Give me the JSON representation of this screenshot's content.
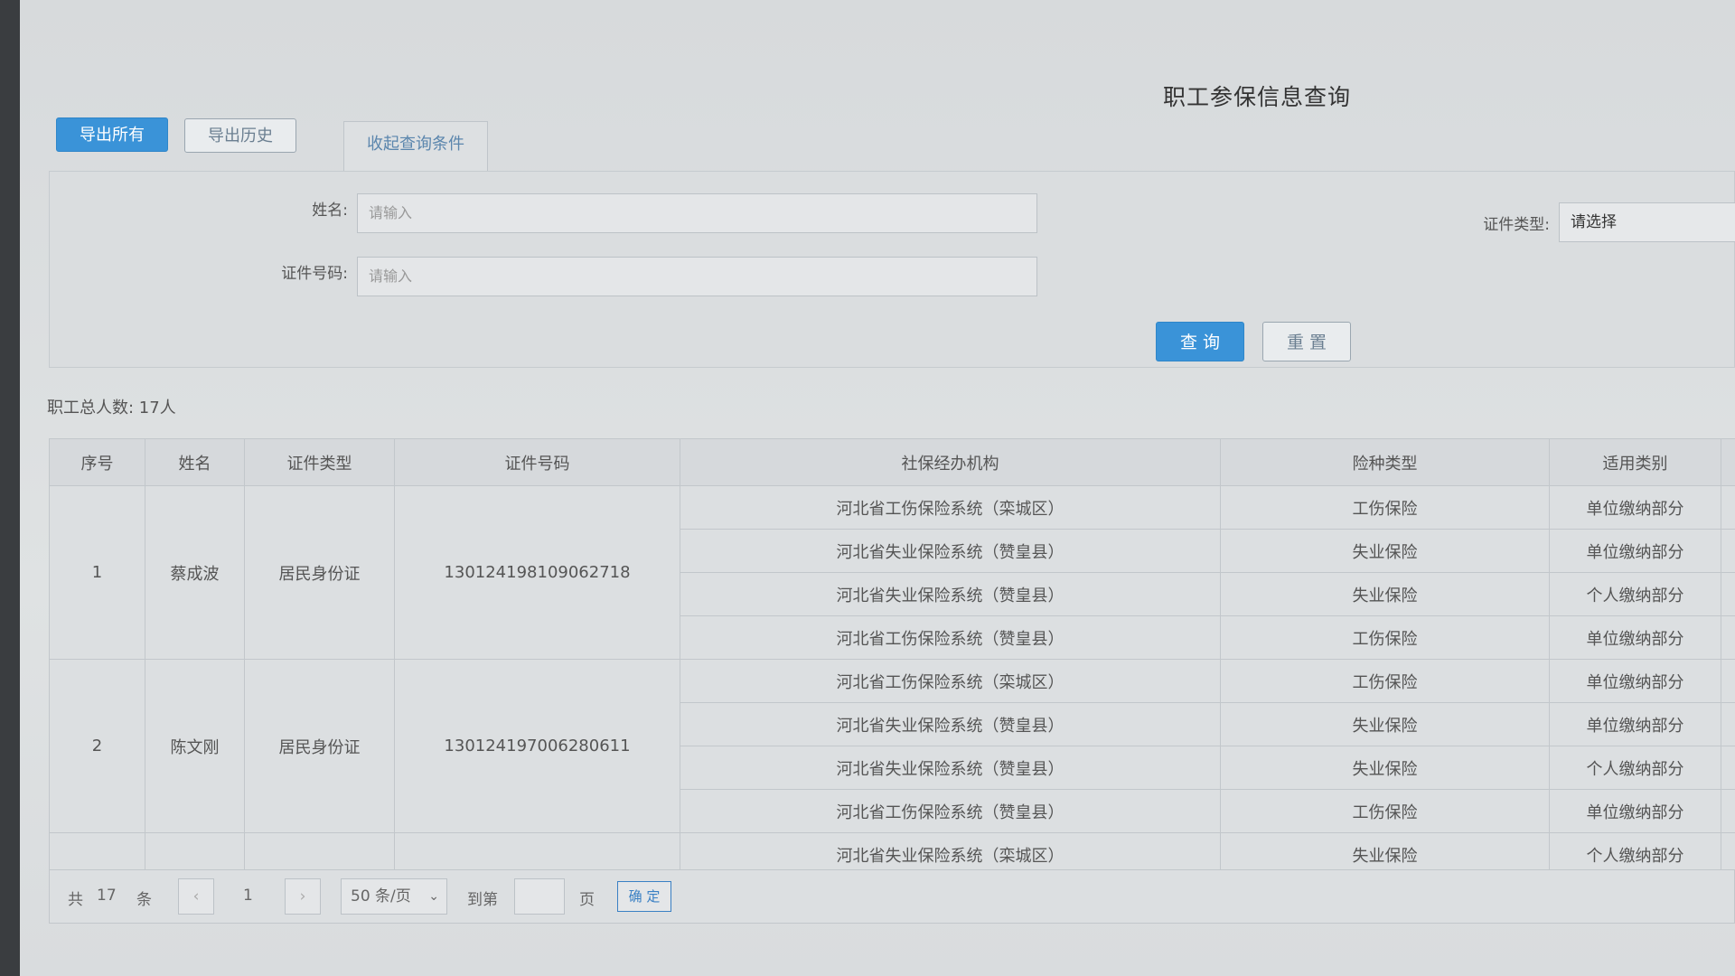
{
  "page": {
    "title": "职工参保信息查询"
  },
  "toolbar": {
    "export_all_label": "导出所有",
    "export_history_label": "导出历史",
    "collapse_label": "收起查询条件"
  },
  "query": {
    "name_label": "姓名:",
    "name_placeholder": "请输入",
    "id_number_label": "证件号码:",
    "id_number_placeholder": "请输入",
    "id_type_label": "证件类型:",
    "id_type_value": "请选择",
    "search_label": "查 询",
    "reset_label": "重 置"
  },
  "summary": {
    "total_text": "职工总人数: 17人"
  },
  "table": {
    "headers": [
      "序号",
      "姓名",
      "证件类型",
      "证件号码",
      "社保经办机构",
      "险种类型",
      "适用类别"
    ],
    "people": [
      {
        "index": "1",
        "name": "蔡成波",
        "id_type": "居民身份证",
        "id_number": "130124198109062718",
        "records": [
          {
            "agency": "河北省工伤保险系统（栾城区）",
            "insurance": "工伤保险",
            "category": "单位缴纳部分"
          },
          {
            "agency": "河北省失业保险系统（赞皇县）",
            "insurance": "失业保险",
            "category": "单位缴纳部分"
          },
          {
            "agency": "河北省失业保险系统（赞皇县）",
            "insurance": "失业保险",
            "category": "个人缴纳部分"
          },
          {
            "agency": "河北省工伤保险系统（赞皇县）",
            "insurance": "工伤保险",
            "category": "单位缴纳部分"
          }
        ]
      },
      {
        "index": "2",
        "name": "陈文刚",
        "id_type": "居民身份证",
        "id_number": "130124197006280611",
        "records": [
          {
            "agency": "河北省工伤保险系统（栾城区）",
            "insurance": "工伤保险",
            "category": "单位缴纳部分"
          },
          {
            "agency": "河北省失业保险系统（赞皇县）",
            "insurance": "失业保险",
            "category": "单位缴纳部分"
          },
          {
            "agency": "河北省失业保险系统（赞皇县）",
            "insurance": "失业保险",
            "category": "个人缴纳部分"
          },
          {
            "agency": "河北省工伤保险系统（赞皇县）",
            "insurance": "工伤保险",
            "category": "单位缴纳部分"
          }
        ]
      },
      {
        "index": "",
        "name": "",
        "id_type": "",
        "id_number": "",
        "records": [
          {
            "agency": "河北省失业保险系统（栾城区）",
            "insurance": "失业保险",
            "category": "个人缴纳部分"
          }
        ]
      }
    ]
  },
  "pagination": {
    "total_prefix": "共",
    "total_count": "17",
    "total_suffix": "条",
    "prev_icon": "‹",
    "current_page": "1",
    "next_icon": "›",
    "page_size": "50 条/页",
    "goto_label": "到第",
    "page_unit": "页",
    "confirm_label": "确 定"
  }
}
